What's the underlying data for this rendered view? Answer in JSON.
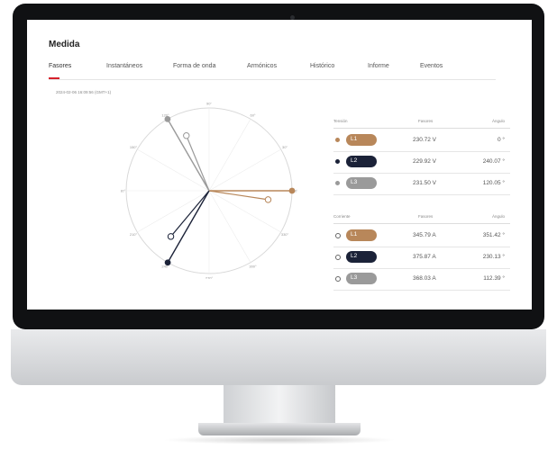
{
  "colors": {
    "l1": "#b8875a",
    "l2": "#1b2238",
    "l3": "#9a9a9a",
    "accent": "#d6202b"
  },
  "page_title": "Medida",
  "tabs": [
    {
      "label": "Fasores",
      "active": true
    },
    {
      "label": "Instantáneos",
      "active": false
    },
    {
      "label": "Forma de onda",
      "active": false
    },
    {
      "label": "Armónicos",
      "active": false
    },
    {
      "label": "Histórico",
      "active": false
    },
    {
      "label": "Informe",
      "active": false
    },
    {
      "label": "Eventos",
      "active": false
    }
  ],
  "timestamp": "2024-02-06 16:09:56 (GMT+1)",
  "diagram_ticks": [
    "0°",
    "30°",
    "60°",
    "90°",
    "120°",
    "150°",
    "180°",
    "210°",
    "240°",
    "270°",
    "300°",
    "330°"
  ],
  "phasors": {
    "voltage": [
      {
        "name": "L1",
        "angle_deg": 0
      },
      {
        "name": "L2",
        "angle_deg": 240.07
      },
      {
        "name": "L3",
        "angle_deg": 120.05
      }
    ],
    "current": [
      {
        "name": "L1",
        "angle_deg": 351.42
      },
      {
        "name": "L2",
        "angle_deg": 230.13
      },
      {
        "name": "L3",
        "angle_deg": 112.39
      }
    ]
  },
  "voltage_table": {
    "header": {
      "label": "Tensión",
      "col_value": "Fasores",
      "col_angle": "Ángulo"
    },
    "rows": [
      {
        "phase": "L1",
        "value": "230.72 V",
        "angle": "0 °"
      },
      {
        "phase": "L2",
        "value": "229.92 V",
        "angle": "240.07 °"
      },
      {
        "phase": "L3",
        "value": "231.50 V",
        "angle": "120.05 °"
      }
    ]
  },
  "current_table": {
    "header": {
      "label": "Corriente",
      "col_value": "Fasores",
      "col_angle": "Ángulo"
    },
    "rows": [
      {
        "phase": "L1",
        "value": "345.79 A",
        "angle": "351.42 °"
      },
      {
        "phase": "L2",
        "value": "375.87 A",
        "angle": "230.13 °"
      },
      {
        "phase": "L3",
        "value": "368.03 A",
        "angle": "112.39 °"
      }
    ]
  }
}
